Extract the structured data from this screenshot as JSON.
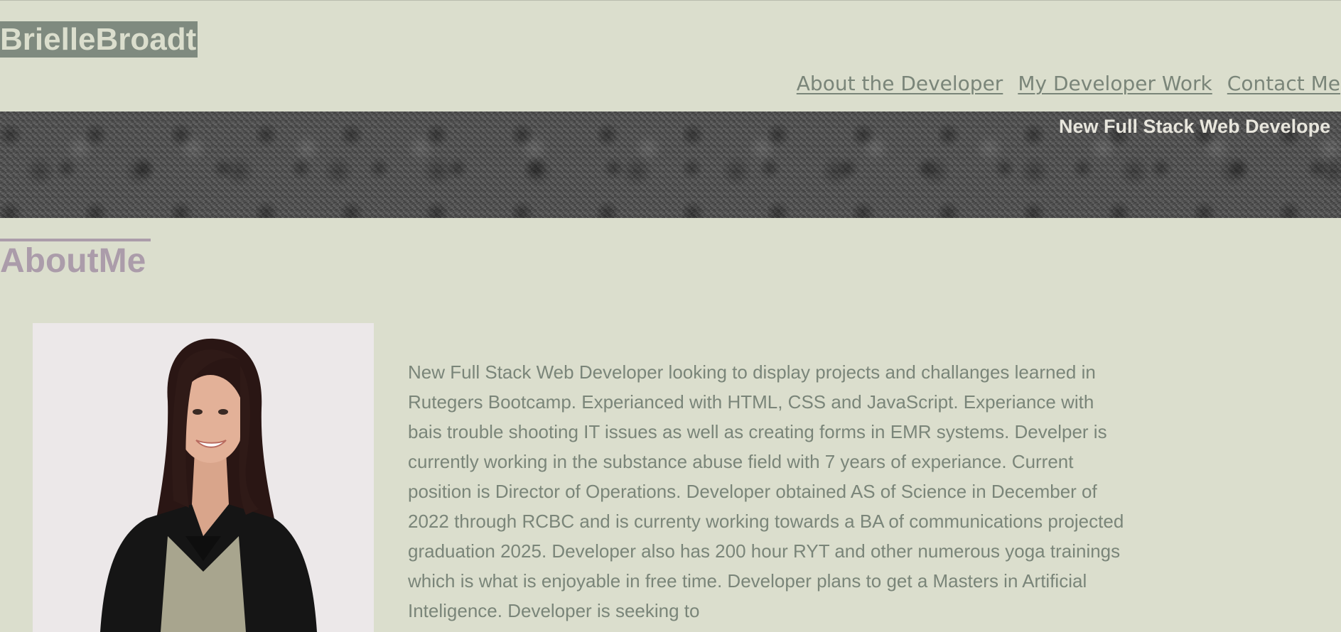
{
  "header": {
    "logo_text": "BrielleBroadt",
    "nav": [
      {
        "label": "About the Developer"
      },
      {
        "label": "My Developer Work"
      },
      {
        "label": "Contact Me"
      }
    ]
  },
  "hero": {
    "tagline": "New Full Stack Web Develope"
  },
  "about": {
    "title": "AboutMe",
    "bio": "New Full Stack Web Developer looking to display projects and challanges learned in Rutegers Bootcamp. Experianced with HTML, CSS and JavaScript. Experiance with bais trouble shooting IT issues as well as creating forms in EMR systems. Develper is currently working in the substance abuse field with 7 years of experiance. Current position is Director of Operations. Developer obtained AS of Science in December of 2022 through RCBC and is currenty working towards a BA of communications projected graduation 2025. Developer also has 200 hour RYT and other numerous yoga trainings which is what is enjoyable in free time. Developer plans to get a Masters in Artificial Inteligence. Developer is seeking to"
  },
  "colors": {
    "page_background": "#dbdecd",
    "logo_background": "#7f8a7f",
    "nav_link": "#7a8579",
    "accent_heading": "#ab9caa",
    "hero_text": "#e8e6dd"
  }
}
